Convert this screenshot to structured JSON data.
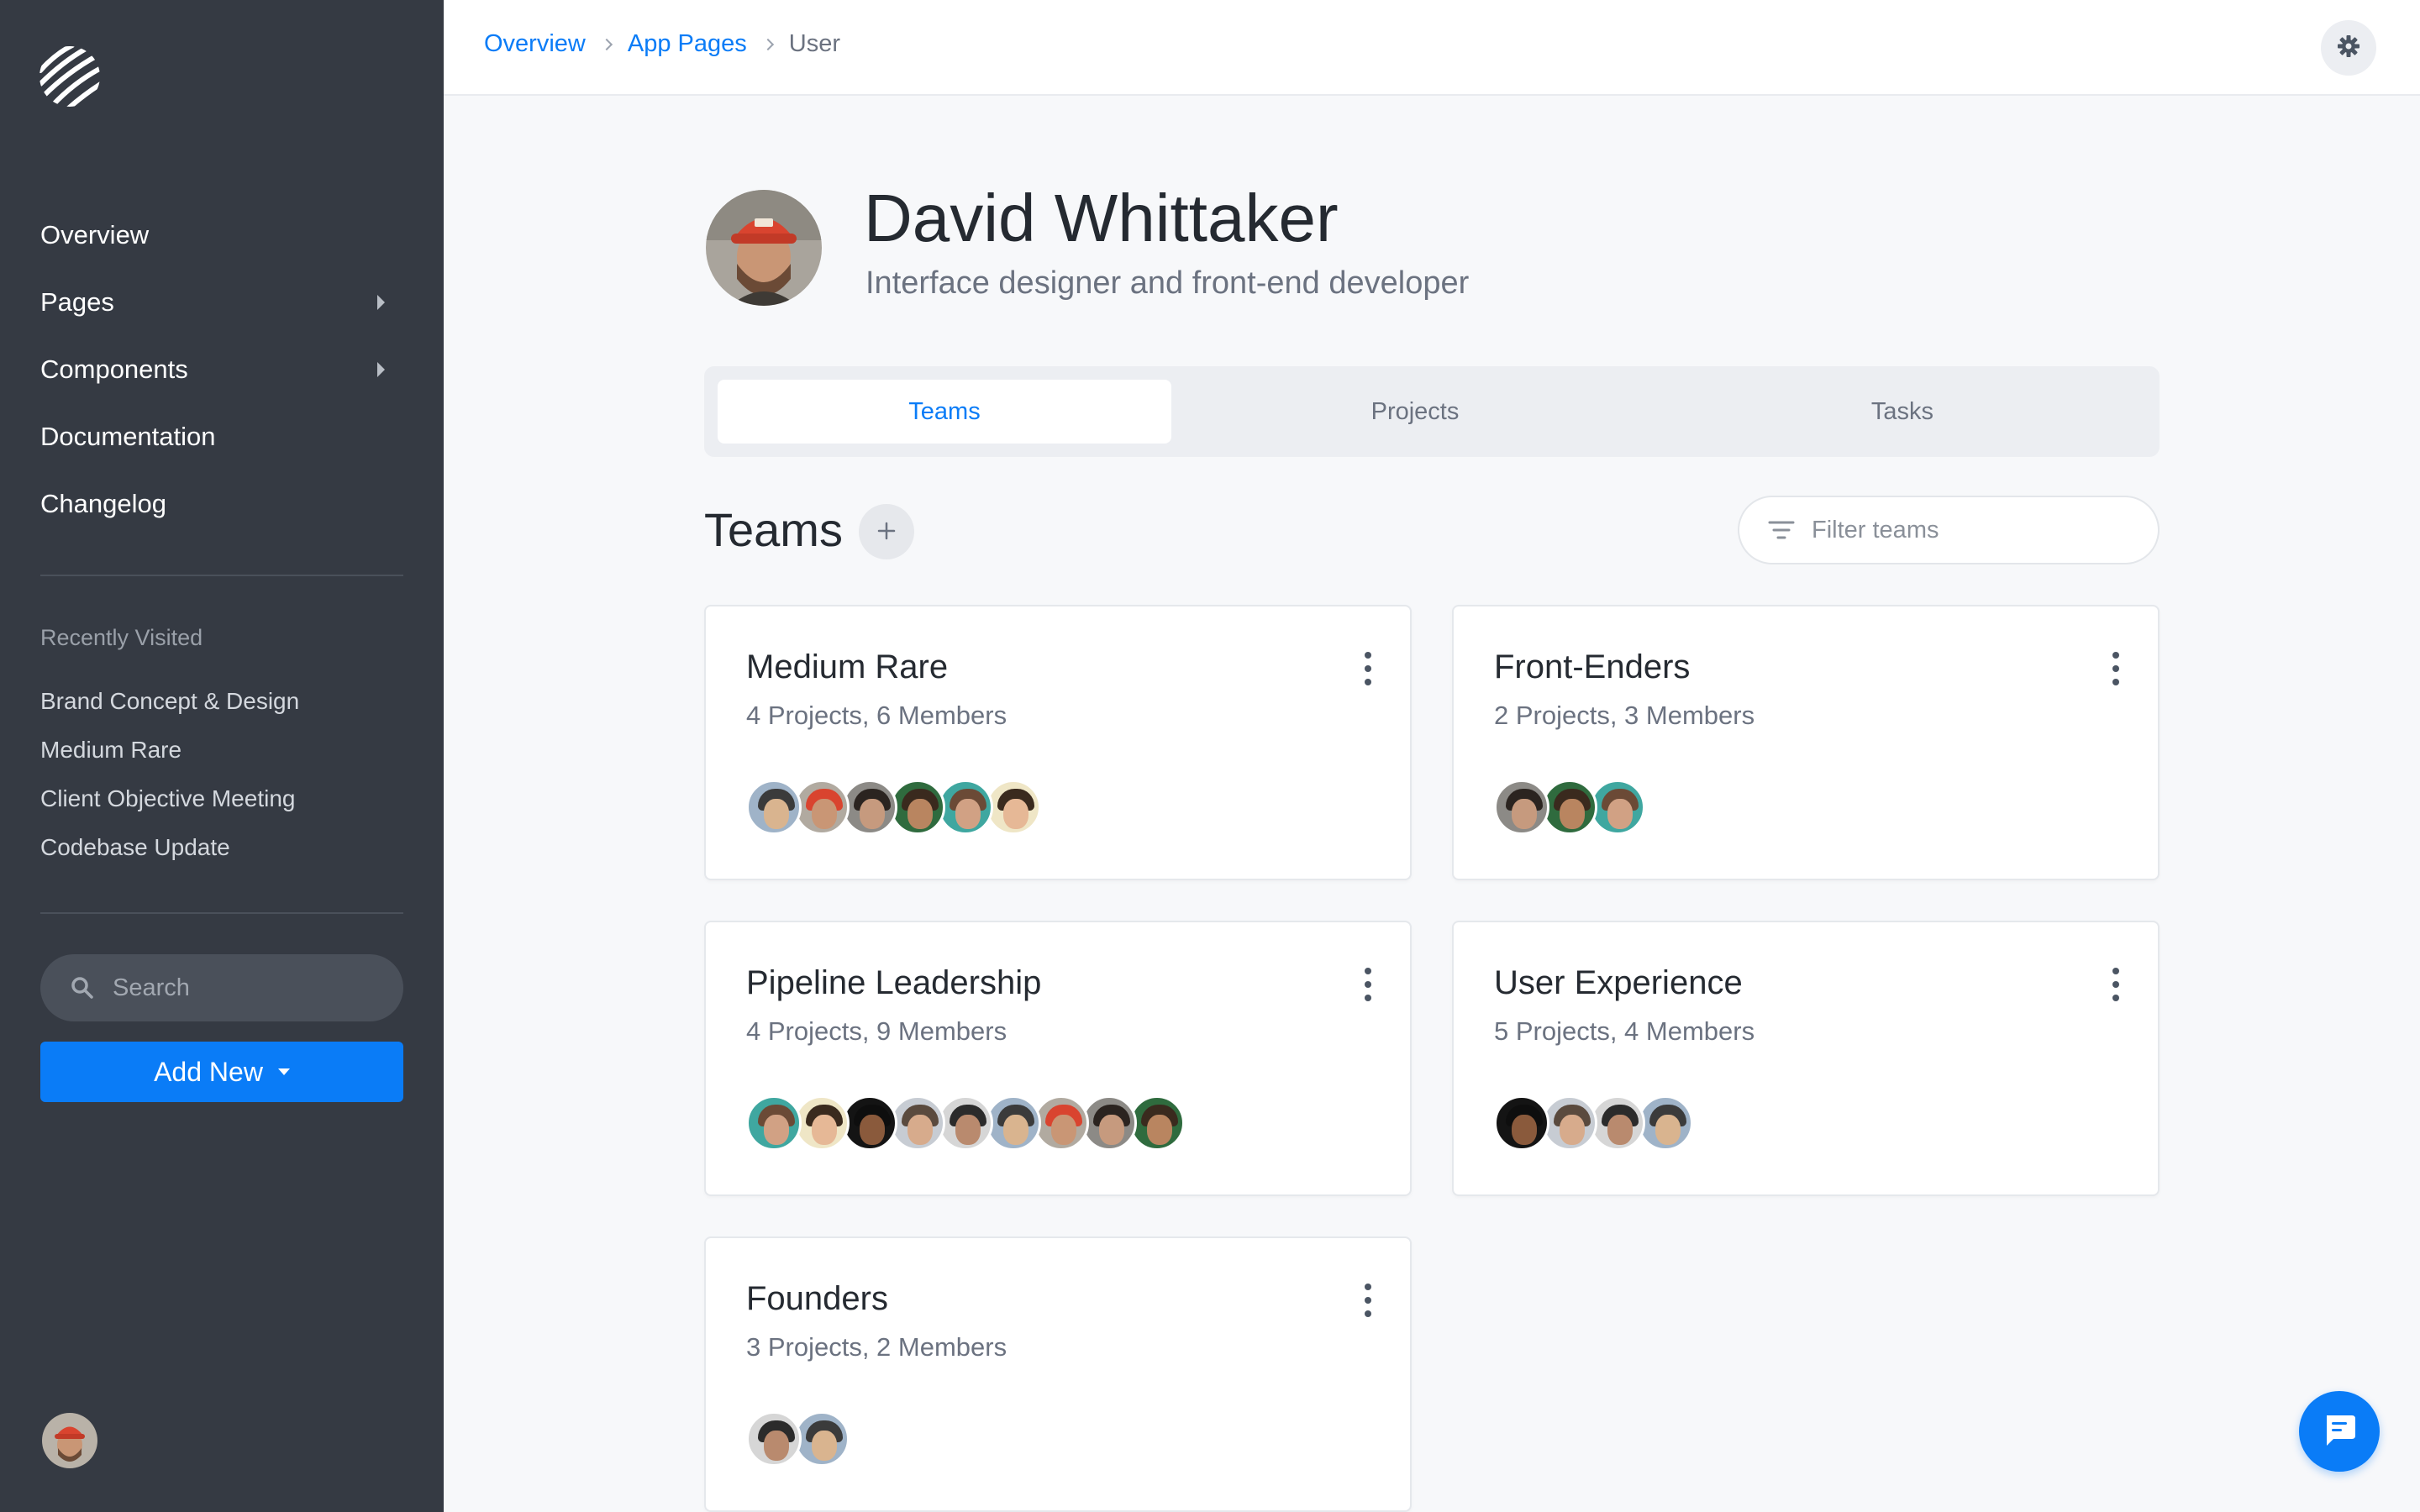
{
  "sidebar": {
    "nav": [
      {
        "label": "Overview",
        "has_submenu": false
      },
      {
        "label": "Pages",
        "has_submenu": true
      },
      {
        "label": "Components",
        "has_submenu": true
      },
      {
        "label": "Documentation",
        "has_submenu": false
      },
      {
        "label": "Changelog",
        "has_submenu": false
      }
    ],
    "recent_heading": "Recently Visited",
    "recent": [
      "Brand Concept & Design",
      "Medium Rare",
      "Client Objective Meeting",
      "Codebase Update"
    ],
    "search_placeholder": "Search",
    "add_new_label": "Add New"
  },
  "breadcrumb": {
    "items": [
      "Overview",
      "App Pages"
    ],
    "current": "User"
  },
  "profile": {
    "name": "David Whittaker",
    "title": "Interface designer and front-end developer"
  },
  "tabs": [
    {
      "label": "Teams",
      "active": true
    },
    {
      "label": "Projects",
      "active": false
    },
    {
      "label": "Tasks",
      "active": false
    }
  ],
  "teams_section": {
    "title": "Teams",
    "filter_placeholder": "Filter teams"
  },
  "teams": [
    {
      "name": "Medium Rare",
      "meta": "4 Projects, 6 Members",
      "members": 6
    },
    {
      "name": "Front-Enders",
      "meta": "2 Projects, 3 Members",
      "members": 3
    },
    {
      "name": "Pipeline Leadership",
      "meta": "4 Projects, 9 Members",
      "members": 9
    },
    {
      "name": "User Experience",
      "meta": "5 Projects, 4 Members",
      "members": 4
    },
    {
      "name": "Founders",
      "meta": "3 Projects, 2 Members",
      "members": 2
    }
  ],
  "colors": {
    "accent": "#0a7cf7",
    "sidebar_bg": "#353a43",
    "page_bg": "#f7f8fa"
  }
}
